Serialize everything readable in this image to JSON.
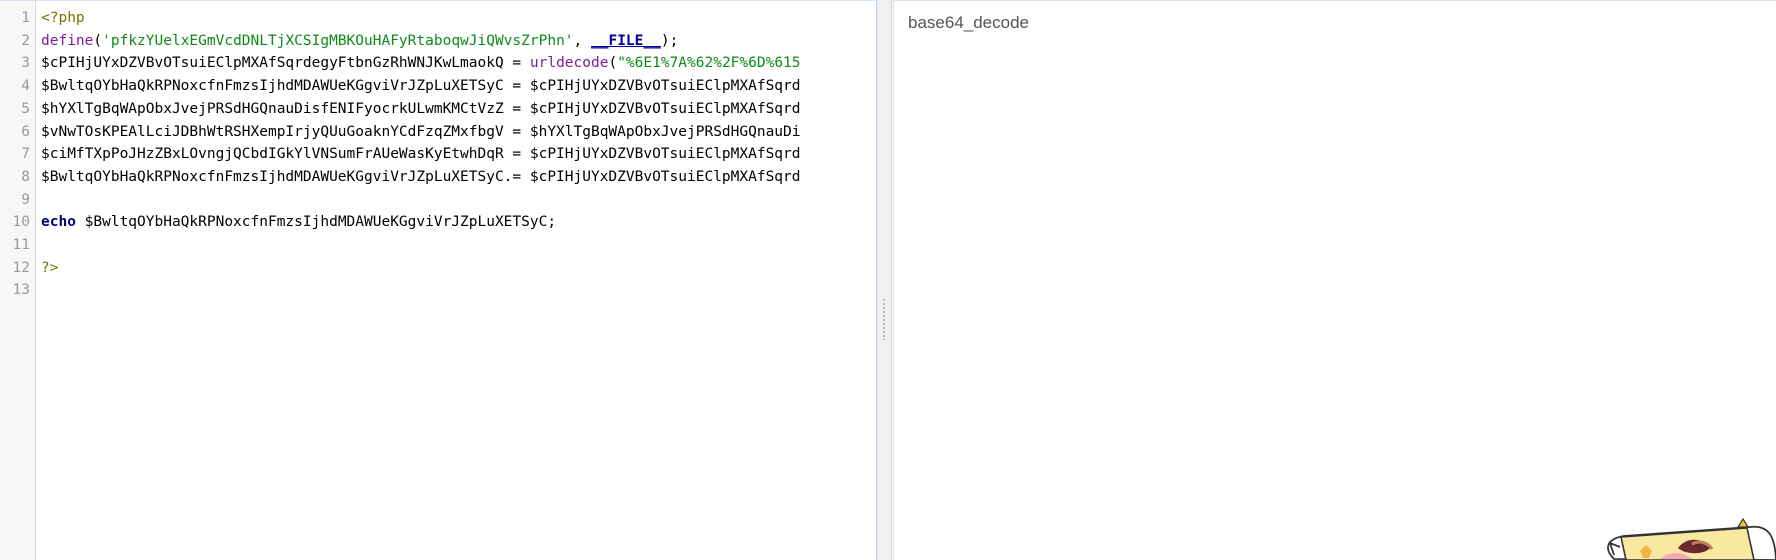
{
  "editor": {
    "line_numbers": [
      "1",
      "2",
      "3",
      "4",
      "5",
      "6",
      "7",
      "8",
      "9",
      "10",
      "11",
      "12",
      "13"
    ],
    "lines": [
      {
        "segments": [
          {
            "t": "<?php",
            "c": "kw-php"
          }
        ]
      },
      {
        "segments": [
          {
            "t": "define",
            "c": "fn"
          },
          {
            "t": "(",
            "c": ""
          },
          {
            "t": "'pfkzYUelxEGmVcdDNLTjXCSIgMBKOuHAFyRtaboqwJiQWvsZrPhn'",
            "c": "str"
          },
          {
            "t": ", ",
            "c": ""
          },
          {
            "t": "__FILE__",
            "c": "const"
          },
          {
            "t": ");",
            "c": ""
          }
        ]
      },
      {
        "segments": [
          {
            "t": "$cPIHjUYxDZVBvOTsuiEClpMXAfSqrdegyFtbnGzRhWNJKwLmaokQ = ",
            "c": ""
          },
          {
            "t": "urldecode",
            "c": "fn"
          },
          {
            "t": "(",
            "c": ""
          },
          {
            "t": "\"%6E1%7A%62%2F%6D%615",
            "c": "str"
          }
        ]
      },
      {
        "segments": [
          {
            "t": "$BwltqOYbHaQkRPNoxcfnFmzsIjhdMDAWUeKGgviVrJZpLuXETSyC = $cPIHjUYxDZVBvOTsuiEClpMXAfSqrd",
            "c": ""
          }
        ]
      },
      {
        "segments": [
          {
            "t": "$hYXlTgBqWApObxJvejPRSdHGQnauDisfENIFyocrkULwmKMCtVzZ = $cPIHjUYxDZVBvOTsuiEClpMXAfSqrd",
            "c": ""
          }
        ]
      },
      {
        "segments": [
          {
            "t": "$vNwTOsKPEAlLciJDBhWtRSHXempIrjyQUuGoaknYCdFzqZMxfbgV = $hYXlTgBqWApObxJvejPRSdHGQnauDi",
            "c": ""
          }
        ]
      },
      {
        "segments": [
          {
            "t": "$ciMfTXpPoJHzZBxLOvngjQCbdIGkYlVNSumFrAUeWasKyEtwhDqR = $cPIHjUYxDZVBvOTsuiEClpMXAfSqrd",
            "c": ""
          }
        ]
      },
      {
        "segments": [
          {
            "t": "$BwltqOYbHaQkRPNoxcfnFmzsIjhdMDAWUeKGgviVrJZpLuXETSyC.= $cPIHjUYxDZVBvOTsuiEClpMXAfSqrd",
            "c": ""
          }
        ]
      },
      {
        "segments": []
      },
      {
        "segments": [
          {
            "t": "echo",
            "c": "kw"
          },
          {
            "t": " $BwltqOYbHaQkRPNoxcfnFmzsIjhdMDAWUeKGgviVrJZpLuXETSyC;",
            "c": ""
          }
        ]
      },
      {
        "segments": []
      },
      {
        "segments": [
          {
            "t": "?>",
            "c": "kw-php"
          }
        ]
      },
      {
        "segments": []
      }
    ]
  },
  "output": {
    "text": "base64_decode"
  },
  "icons": {
    "splitter": "drag-handle-icon",
    "mascot": "mascot-sticker-icon"
  }
}
